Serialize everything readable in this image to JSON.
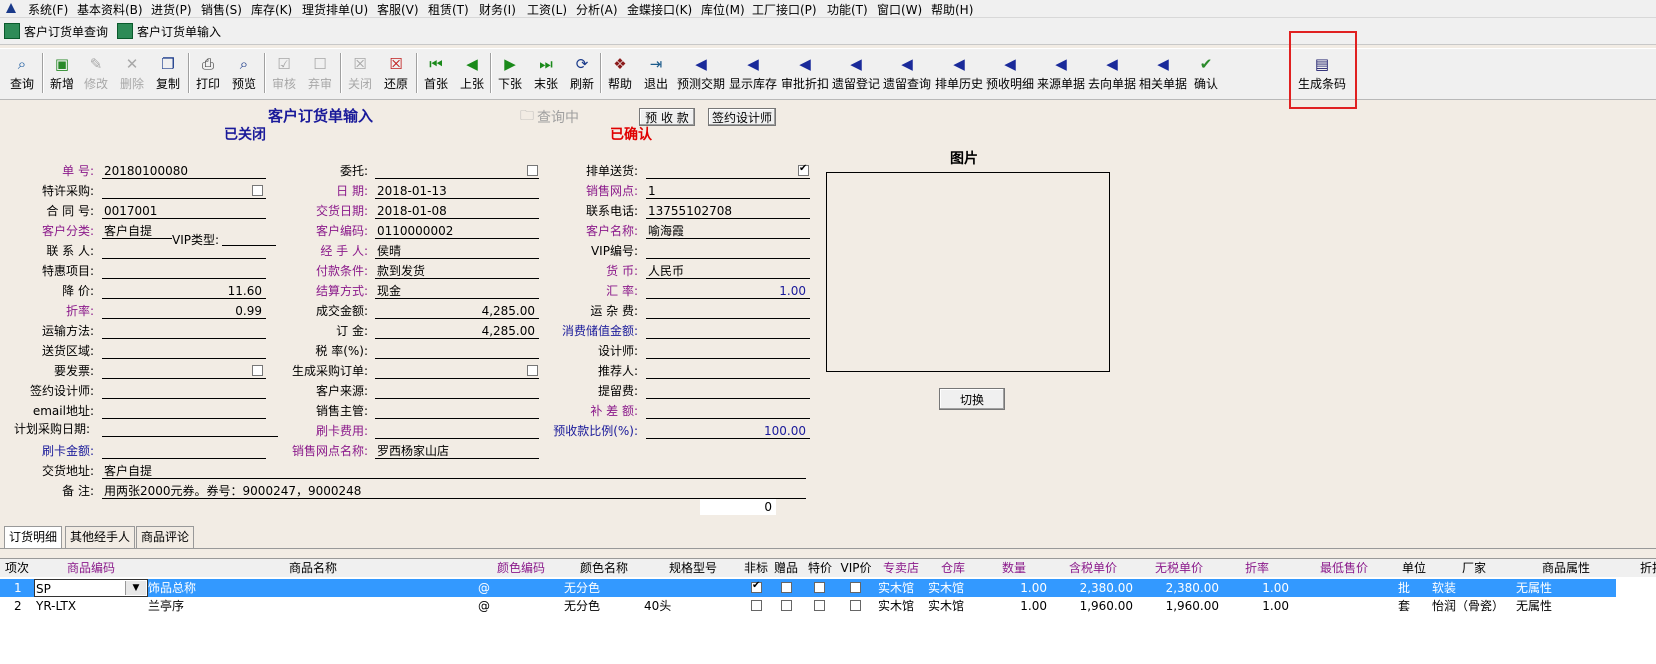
{
  "menu": [
    "系统(F)",
    "基本资料(B)",
    "进货(P)",
    "销售(S)",
    "库存(K)",
    "理货排单(U)",
    "客服(V)",
    "租赁(T)",
    "财务(I)",
    "工资(L)",
    "分析(A)",
    "金蝶接口(K)",
    "库位(M)",
    "工厂接口(P)",
    "功能(T)",
    "窗口(W)",
    "帮助(H)"
  ],
  "wintabs": [
    "客户订货单查询",
    "客户订货单输入"
  ],
  "toolbar": {
    "query": "查询",
    "new": "新增",
    "modify": "修改",
    "delete": "删除",
    "copy": "复制",
    "print": "打印",
    "preview": "预览",
    "review": "审核",
    "abandon": "弃审",
    "close": "关闭",
    "restore": "还原",
    "first": "首张",
    "prev": "上张",
    "next": "下张",
    "last": "末张",
    "refresh": "刷新",
    "help": "帮助",
    "exit": "退出",
    "forecast": "预测交期",
    "show_stock": "显示库存",
    "approve_discount": "审批折扣",
    "lost_register": "遗留登记",
    "lost_query": "遗留查询",
    "schedule_history": "排单历史",
    "prepay_detail": "预收明细",
    "source_doc": "来源单据",
    "target_doc": "去向单据",
    "related_doc": "相关单据",
    "confirm": "确认",
    "gen_barcode": "生成条码"
  },
  "header": {
    "title": "客户订货单输入",
    "status_closed": "已关闭",
    "status_confirmed": "已确认",
    "querying": "查询中",
    "btn_prepay": "预 收 款",
    "btn_designer": "签约设计师",
    "picture_title": "图片",
    "btn_switch": "切换"
  },
  "form": {
    "l_no": "单    号:",
    "v_no": "20180100080",
    "l_special": "特许采购:",
    "l_contract": "合 同 号:",
    "v_contract": "0017001",
    "l_cust_cat": "客户分类:",
    "v_cust_cat": "客户自提",
    "l_vip_type": "VIP类型:",
    "l_contact": "联 系 人:",
    "l_preferential": "特惠项目:",
    "l_price_cut": "降    价:",
    "v_price_cut": "11.60",
    "l_discount": "折率:",
    "v_discount": "0.99",
    "l_transport": "运输方法:",
    "l_area": "送货区域:",
    "l_invoice": "要发票:",
    "l_designer": "签约设计师:",
    "l_email": "email地址:",
    "l_plan_date": "计划采购日期:",
    "l_card_amt": "刷卡金额:",
    "l_delivery_addr": "交货地址:",
    "v_delivery_addr": "客户自提",
    "l_remark": "备    注:",
    "v_remark": "用两张2000元券。券号：9000247，9000248",
    "l_entrust": "委托:",
    "l_date": "日    期:",
    "v_date": "2018-01-13",
    "l_delivery_date": "交货日期:",
    "v_delivery_date": "2018-01-08",
    "l_cust_code": "客户编码:",
    "v_cust_code": "0110000002",
    "l_handler": "经 手 人:",
    "v_handler": "侯晴",
    "l_pay_terms": "付款条件:",
    "v_pay_terms": "款到发货",
    "l_settle": "结算方式:",
    "v_settle": "现金",
    "l_deal_amt": "成交金额:",
    "v_deal_amt": "4,285.00",
    "l_deposit": "订    金:",
    "v_deposit": "4,285.00",
    "l_tax": "税  率(%):",
    "l_gen_po": "生成采购订单:",
    "l_cust_source": "客户来源:",
    "l_sales_mgr": "销售主管:",
    "l_card_fee": "刷卡费用:",
    "l_outlet_name": "销售网点名称:",
    "v_outlet_name": "罗西杨家山店",
    "l_schedule": "排单送货:",
    "l_outlet": "销售网点:",
    "v_outlet": "1",
    "l_phone": "联系电话:",
    "v_phone": "13755102708",
    "l_cust_name": "客户名称:",
    "v_cust_name": "喻海霞",
    "l_vip_no": "VIP编号:",
    "l_currency": "货    币:",
    "v_currency": "人民币",
    "l_rate": "汇    率:",
    "v_rate": "1.00",
    "l_freight": "运 杂 费:",
    "l_stored": "消费储值金额:",
    "l_designer2": "设计师:",
    "l_recommender": "推荐人:",
    "l_retain": "提留费:",
    "l_balance": "补 差 额:",
    "l_prepay_ratio": "预收款比例(%):",
    "v_prepay_ratio": "100.00",
    "v_counter": "0"
  },
  "bottom_tabs": [
    "订货明细",
    "其他经手人",
    "商品评论"
  ],
  "grid": {
    "headers": [
      "项次",
      "商品编码",
      "商品名称",
      "颜色编码",
      "颜色名称",
      "规格型号",
      "非标",
      "赠品",
      "特价",
      "VIP价",
      "专卖店",
      "仓库",
      "数量",
      "含税单价",
      "无税单价",
      "折率",
      "最低售价",
      "单位",
      "厂家",
      "商品属性",
      "折扣"
    ],
    "rows": [
      {
        "idx": "1",
        "code": "SP",
        "name": "饰品总称",
        "color_code": "@",
        "color_name": "无分色",
        "spec": "",
        "nonstd": true,
        "gift": false,
        "special": false,
        "vip": false,
        "shop": "实木馆",
        "warehouse": "实木馆",
        "qty": "1.00",
        "price_tax": "2,380.00",
        "price_notax": "2,380.00",
        "rate": "1.00",
        "min_price": "",
        "unit": "批",
        "maker": "软装",
        "attr": "无属性"
      },
      {
        "idx": "2",
        "code": "YR-LTX",
        "name": "兰亭序",
        "color_code": "@",
        "color_name": "无分色",
        "spec": "40头",
        "nonstd": false,
        "gift": false,
        "special": false,
        "vip": false,
        "shop": "实木馆",
        "warehouse": "实木馆",
        "qty": "1.00",
        "price_tax": "1,960.00",
        "price_notax": "1,960.00",
        "rate": "1.00",
        "min_price": "",
        "unit": "套",
        "maker": "怡润（骨瓷）",
        "attr": "无属性"
      }
    ]
  }
}
